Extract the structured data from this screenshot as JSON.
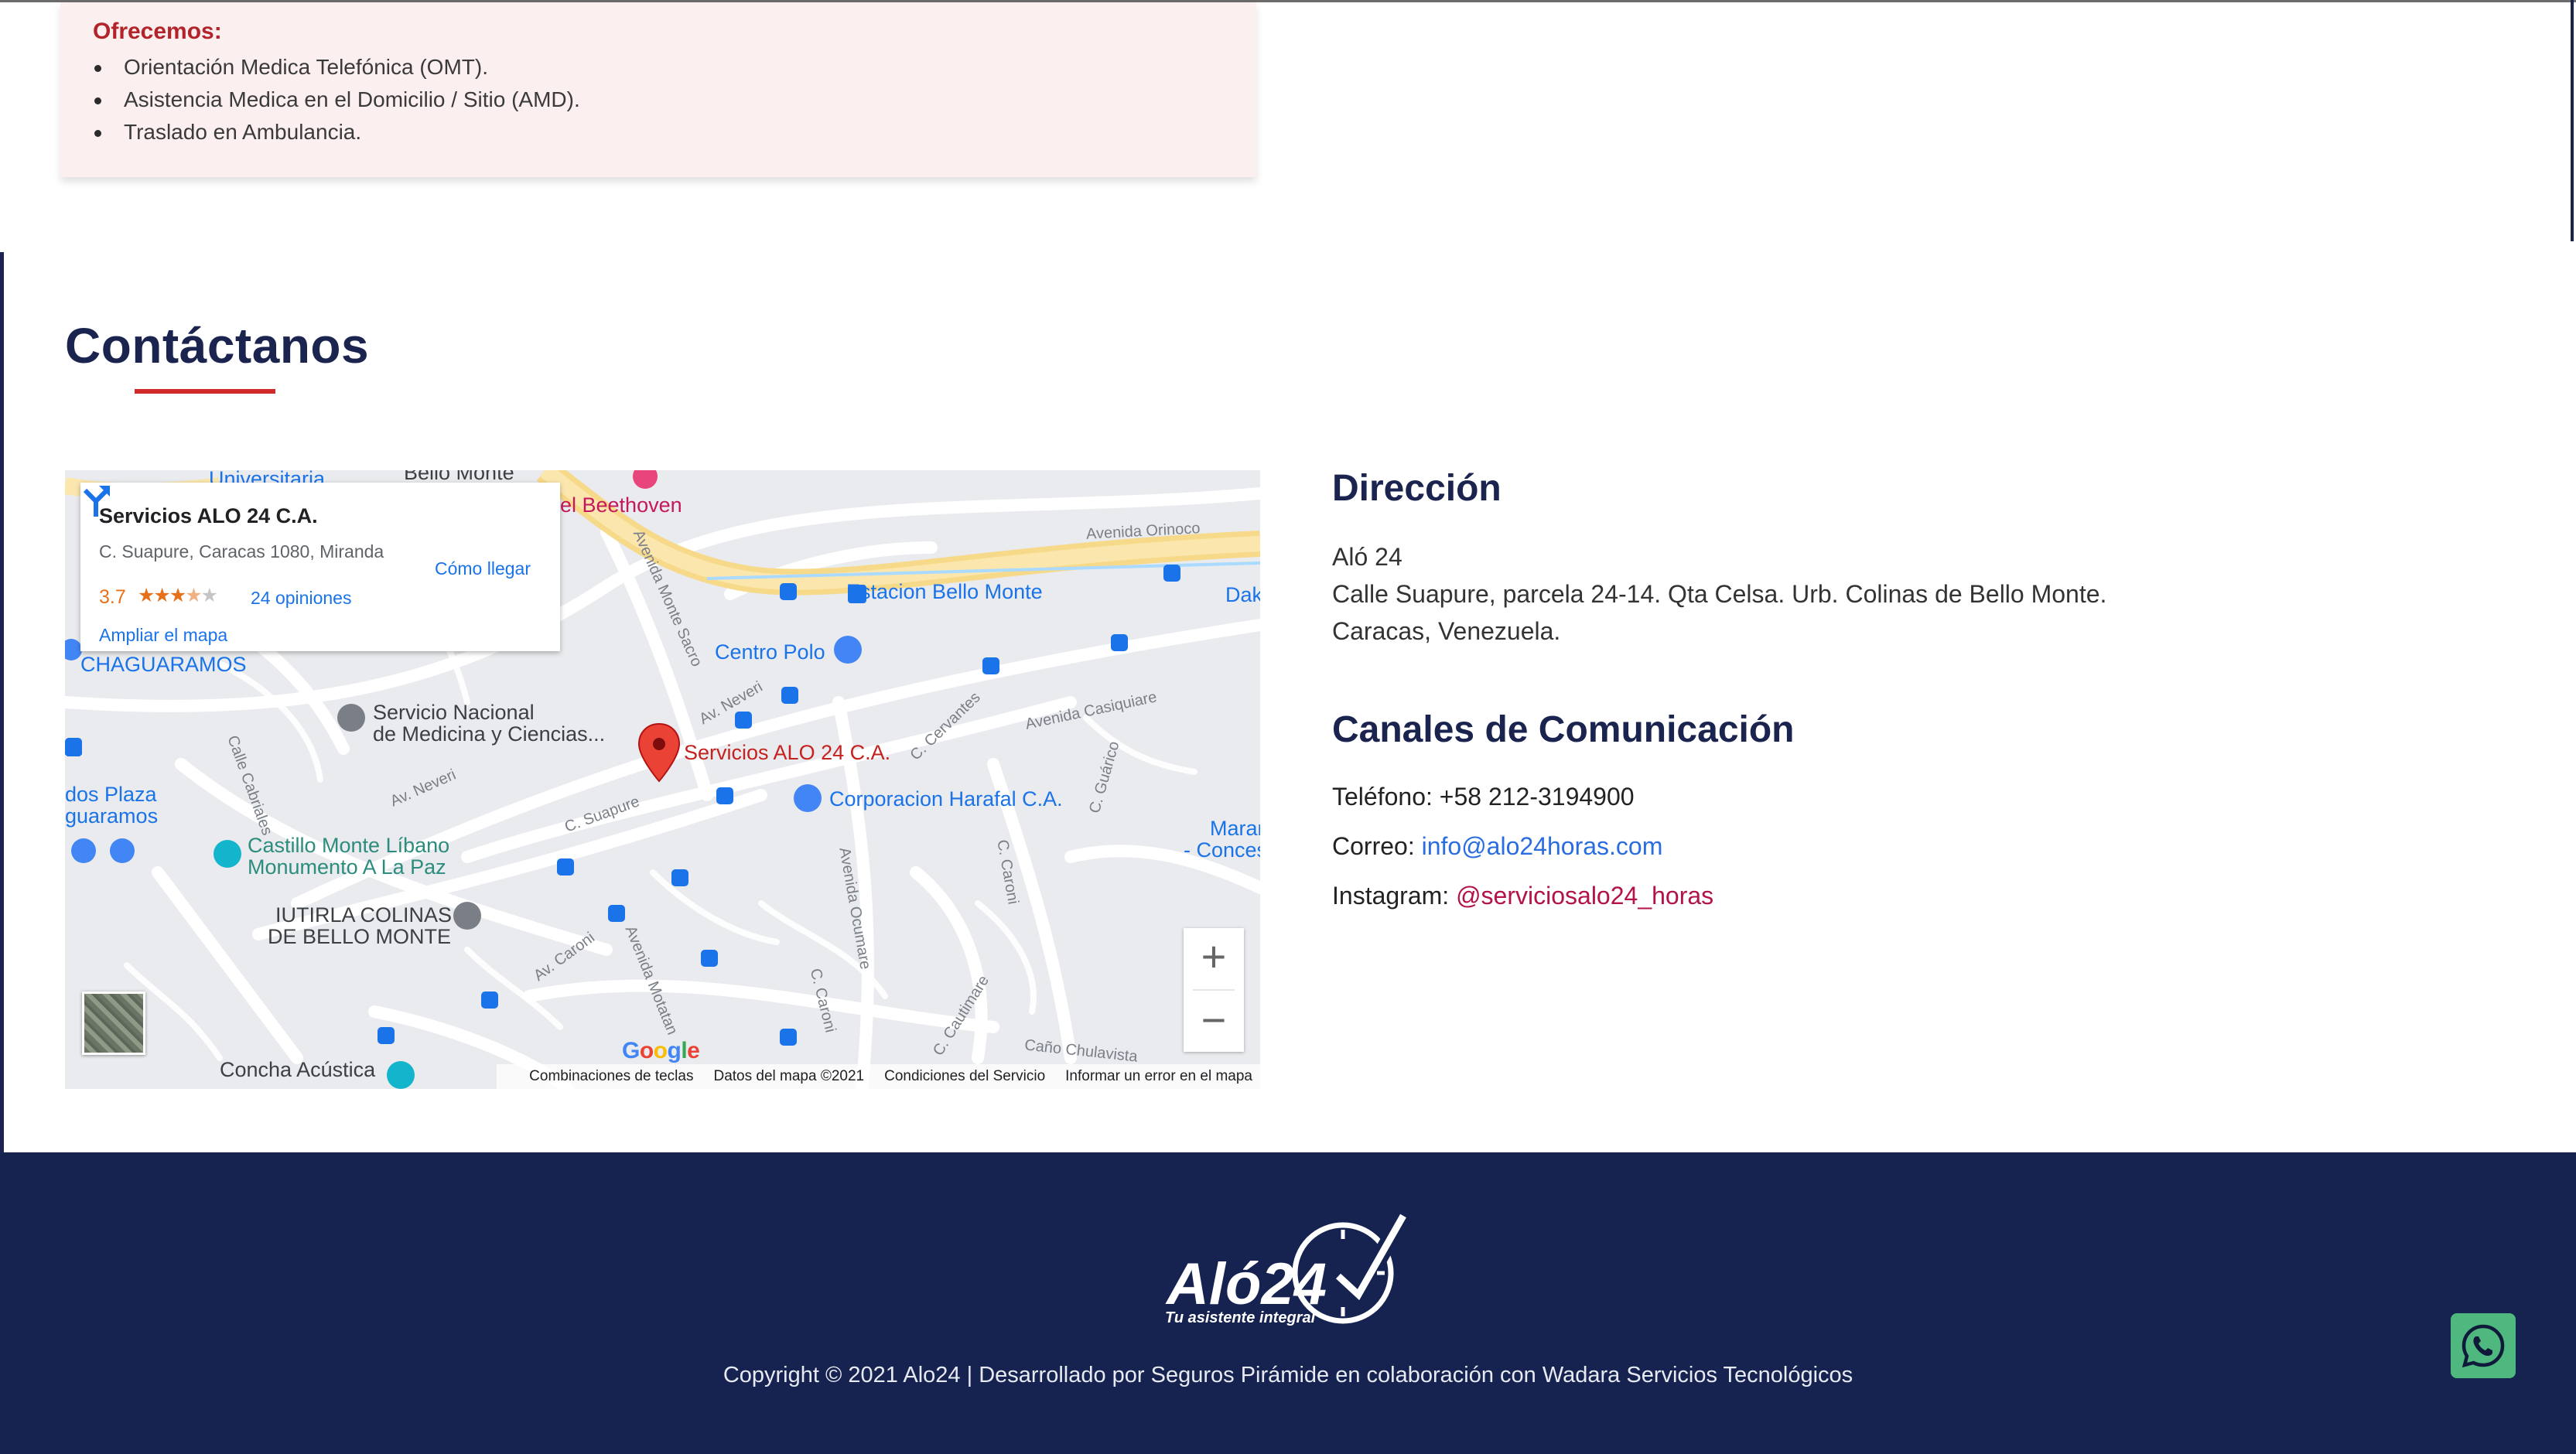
{
  "offer": {
    "title": "Ofrecemos:",
    "items": [
      "Orientación Medica Telefónica (OMT).",
      "Asistencia Medica en el Domicilio / Sitio (AMD).",
      "Traslado en Ambulancia."
    ]
  },
  "contact": {
    "title": "Contáctanos"
  },
  "map": {
    "card": {
      "title": "Servicios ALO 24 C.A.",
      "address": "C. Suapure, Caracas 1080, Miranda",
      "rating": "3.7",
      "stars_filled": 3.5,
      "reviews": "24 opiniones",
      "enlarge": "Ampliar el mapa",
      "directions": "Cómo llegar"
    },
    "labels": {
      "universitaria": "Universitaria",
      "bello_monte": "Bello Monte",
      "beethoven": "el Beethoven",
      "orinoco": "Avenida Orinoco",
      "estacion": "Estacion Bello Monte",
      "dak": "Dak",
      "chaguaramos": "CHAGUARAMOS",
      "centro_polo": "Centro Polo",
      "servicio_nacional_1": "Servicio Nacional",
      "servicio_nacional_2": "de Medicina y Ciencias...",
      "pin_label": "Servicios ALO 24 C.A.",
      "harafal": "Corporacion Harafal C.A.",
      "plaza_1": "dos Plaza",
      "plaza_2": "guaramos",
      "castillo_1": "Castillo Monte Líbano",
      "castillo_2": "Monumento A La Paz",
      "iutirla_1": "IUTIRLA COLINAS",
      "iutirla_2": "DE BELLO MONTE",
      "concha": "Concha Acústica",
      "concha_2": "de Bello Monte",
      "maran_1": "Maran",
      "maran_2": "- Conces",
      "calle_cabriales": "Calle Cabriales",
      "av_neveri_1": "Av. Neveri",
      "av_neveri_2": "Av. Neveri",
      "c_suapure": "C. Suapure",
      "av_caroni": "Av. Caroni",
      "av_motatan": "Avenida Motatan",
      "c_caroni_1": "C. Caroni",
      "c_caroni_2": "C. Caroni",
      "av_ocumare": "Avenida Ocumare",
      "c_cautimare": "C. Cautimare",
      "cane_chulavista": "Caño Chulavista",
      "av_casiquiare": "Avenida Casiquiare",
      "c_cervantes": "C. Cervantes",
      "c_guarico": "C. Guárico",
      "av_monte_sacro": "Avenida Monte Sacro"
    },
    "zoom_in": "+",
    "zoom_out": "−",
    "google": "Google",
    "footer": [
      "Combinaciones de teclas",
      "Datos del mapa ©2021",
      "Condiciones del Servicio",
      "Informar un error en el mapa"
    ]
  },
  "address": {
    "heading": "Dirección",
    "lines": [
      "Aló 24",
      "Calle Suapure, parcela 24-14. Qta Celsa. Urb. Colinas de Bello Monte.",
      "Caracas, Venezuela."
    ]
  },
  "channels": {
    "heading": "Canales de Comunicación",
    "phone_label": "Teléfono: ",
    "phone": "+58 212-3194900",
    "email_label": "Correo: ",
    "email": "info@alo24horas.com",
    "instagram_label": "Instagram: ",
    "instagram": "@serviciosalo24_horas"
  },
  "footer": {
    "logo_text": "Aló24",
    "logo_tagline": "Tu asistente integral",
    "copyright": "Copyright © 2021 Alo24 | Desarrollado por Seguros Pirámide en colaboración con Wadara Servicios Tecnológicos"
  },
  "colors": {
    "navy": "#162350",
    "accent_red": "#d02a2a",
    "offer_bg": "#fcefef",
    "link_blue": "#2a6de0",
    "instagram_link": "#b3124a",
    "whatsapp_green": "#4fb87f"
  },
  "icons": {
    "whatsapp": "whatsapp-icon",
    "directions": "directions-icon",
    "map_pin": "map-pin-icon"
  }
}
